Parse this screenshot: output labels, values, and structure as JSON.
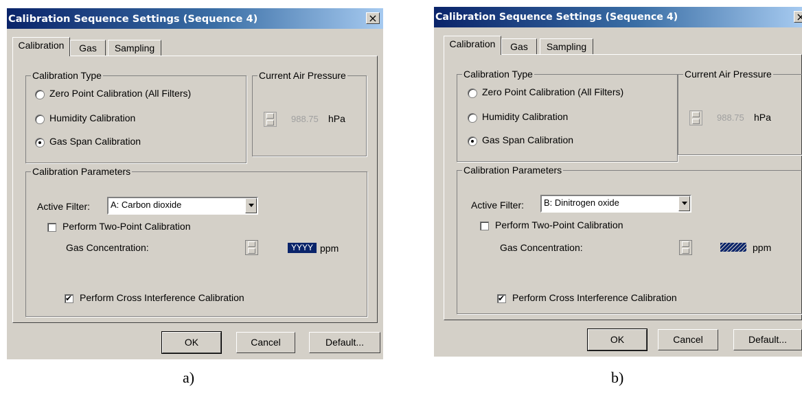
{
  "dialogs": [
    {
      "title": "Calibration Sequence Settings (Sequence 4)",
      "tabs": [
        "Calibration",
        "Gas",
        "Sampling"
      ],
      "active_tab": "Calibration",
      "calibration_type": {
        "legend": "Calibration Type",
        "options": [
          "Zero Point Calibration (All Filters)",
          "Humidity Calibration",
          "Gas Span Calibration"
        ],
        "selected": "Gas Span Calibration"
      },
      "air_pressure": {
        "legend": "Current Air Pressure",
        "value": "988.75",
        "unit": "hPa"
      },
      "parameters": {
        "legend": "Calibration Parameters",
        "active_filter_label": "Active Filter:",
        "active_filter_value": "A: Carbon dioxide",
        "two_point_label": "Perform Two-Point Calibration",
        "two_point_checked": false,
        "gas_concentration_label": "Gas Concentration:",
        "gas_concentration_value": "YYYY",
        "gas_concentration_unit": "ppm",
        "cross_interference_label": "Perform Cross Interference Calibration",
        "cross_interference_checked": true
      },
      "buttons": {
        "ok": "OK",
        "cancel": "Cancel",
        "default": "Default..."
      }
    },
    {
      "title": "Calibration Sequence Settings (Sequence 4)",
      "tabs": [
        "Calibration",
        "Gas",
        "Sampling"
      ],
      "active_tab": "Calibration",
      "calibration_type": {
        "legend": "Calibration Type",
        "options": [
          "Zero Point Calibration (All Filters)",
          "Humidity Calibration",
          "Gas Span Calibration"
        ],
        "selected": "Gas Span Calibration"
      },
      "air_pressure": {
        "legend": "Current Air Pressure",
        "value": "988.75",
        "unit": "hPa"
      },
      "parameters": {
        "legend": "Calibration Parameters",
        "active_filter_label": "Active Filter:",
        "active_filter_value": "B: Dinitrogen oxide",
        "two_point_label": "Perform Two-Point Calibration",
        "two_point_checked": false,
        "gas_concentration_label": "Gas Concentration:",
        "gas_concentration_value": "",
        "gas_concentration_unit": "ppm",
        "cross_interference_label": "Perform Cross Interference Calibration",
        "cross_interference_checked": true
      },
      "buttons": {
        "ok": "OK",
        "cancel": "Cancel",
        "default": "Default..."
      }
    }
  ],
  "captions": [
    "a)",
    "b)"
  ]
}
